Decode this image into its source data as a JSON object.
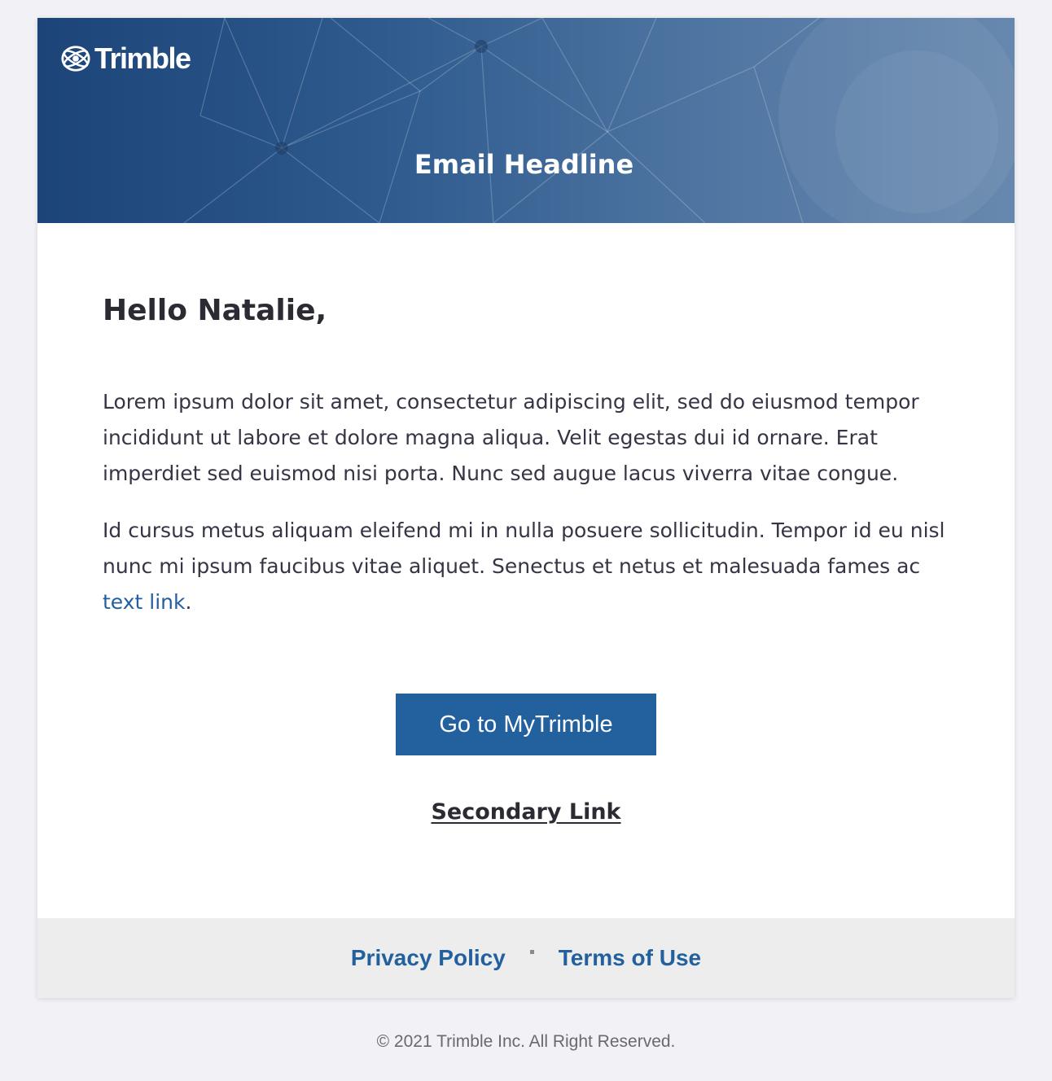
{
  "header": {
    "logo_text": "Trimble",
    "headline": "Email Headline"
  },
  "body": {
    "greeting": "Hello Natalie,",
    "paragraph1": "Lorem ipsum dolor sit amet, consectetur adipiscing elit, sed do eiusmod tempor incididunt ut labore et dolore magna aliqua. Velit egestas dui id ornare. Erat imperdiet sed euismod nisi porta. Nunc sed augue lacus viverra vitae congue.",
    "paragraph2_text": "Id cursus metus aliquam eleifend mi in nulla posuere sollicitudin. Tempor id eu nisl nunc mi ipsum faucibus vitae aliquet. Senectus et netus et malesuada fames ac ",
    "paragraph2_link": "text link",
    "paragraph2_end": ".",
    "cta_label": "Go to MyTrimble",
    "secondary_link": "Secondary Link"
  },
  "footer": {
    "privacy_label": "Privacy Policy",
    "terms_label": "Terms of Use",
    "copyright": "© 2021 Trimble Inc. All Right Reserved."
  },
  "colors": {
    "brand_blue": "#22609e",
    "banner_dark": "#1c4478",
    "page_bg": "#f2f2f6"
  }
}
